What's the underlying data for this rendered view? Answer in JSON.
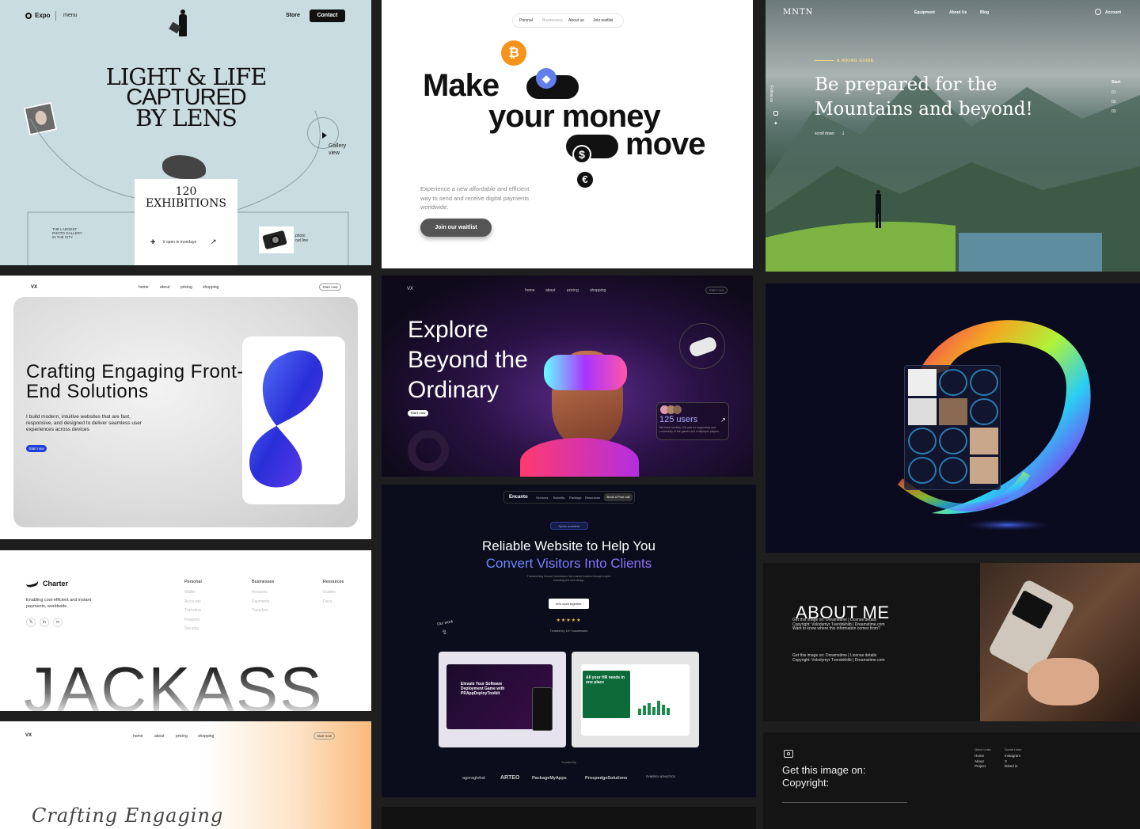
{
  "expo": {
    "logo": "Expo",
    "menu": "menu",
    "store": "Store",
    "contact": "Contact",
    "headline": [
      "LIGHT & LIFE",
      "CAPTURED",
      "BY LENS"
    ],
    "gallery": "Gallery\nview",
    "exhibitions_count": "120",
    "exhibitions_label": "EXHIBITIONS",
    "open_text": "it open in mondays",
    "largest": "THE LARGEST\nPHOTO GALLERY\nIN THE CITY",
    "photo_online": "photo\nout line"
  },
  "money": {
    "nav": [
      "Porsnal",
      "Businesses",
      "About us",
      "Join waitlist"
    ],
    "headline_1": "Make",
    "headline_2": "your money",
    "headline_3": "move",
    "desc": "Experience a new affordable and efficient way to send and receive digital payments worldwide.",
    "cta": "Join our waitlist",
    "coin_colors": {
      "btc": "#f7931a",
      "eth": "#627eea"
    }
  },
  "mntn": {
    "logo": "MNTN",
    "nav": [
      "Equipment",
      "About Us",
      "Blog"
    ],
    "account": "Account",
    "kicker": "A HIKING GUIDE",
    "headline": "Be prepared for the Mountains and beyond!",
    "scroll": "scroll down",
    "side": [
      "Start",
      "01",
      "02",
      "03"
    ],
    "follow": "Follow us"
  },
  "craft": {
    "logo": "VX",
    "nav": [
      "home",
      "about",
      "pricing",
      "shopping"
    ],
    "start_now": "Start now",
    "headline": "Crafting Engaging Front-End Solutions",
    "desc": "I build modern, intuitive websites that are fast, responsive, and designed to deliver seamless user experiences across devices",
    "cta": "Start now"
  },
  "explore": {
    "logo": "VX",
    "nav": [
      "home",
      "about",
      "pricing",
      "shopping"
    ],
    "start_now": "Start now",
    "headline": "Explore Beyond the Ordinary",
    "cta": "Start now",
    "users": "125 users",
    "users_desc": "We have monthly 125 user for supporting and community of the games and multiplayer players"
  },
  "charter": {
    "brand": "Charter",
    "tagline": "Enabling cost-efficient and instant payments, worldwide.",
    "columns": [
      {
        "title": "Personal",
        "items": [
          "Wallet",
          "Accounts",
          "Transfers",
          "Features",
          "Security"
        ]
      },
      {
        "title": "Businesses",
        "items": [
          "Features",
          "Payments",
          "Transfers"
        ]
      },
      {
        "title": "Resources",
        "items": [
          "Guides",
          "Docs"
        ]
      }
    ],
    "big_word": "JACKASS"
  },
  "encanto": {
    "logo": "Encanto",
    "nav": [
      "Services",
      "Benefits",
      "Package",
      "Resources"
    ],
    "book": "Book a Free call",
    "badge": "Spots available",
    "headline_1": "Reliable Website to Help You",
    "headline_2": "Convert Visitors Into Clients",
    "sub": "Transforming finance businesses into market leaders through expert branding and web design",
    "cta": "let's work together",
    "stars": "★★★★★",
    "trusted": "Trusted by 10+ businesses",
    "our_work": "Our work",
    "card1_title": "Elevate Your Software Deployment Game with PRAppDeployToolkit",
    "card2_title": "All your HR needs in one place",
    "trusted_by": "Trusted By",
    "logos": [
      "agoraglobal",
      "ARTEO",
      "PackageMyApps",
      "ProspedgeSolutions",
      "SYNERGY ATHLETICS"
    ]
  },
  "about": {
    "headline": "ABOUT ME",
    "p1": "Get this image on: Dreamstime | License details Copyright: Volodymyr Tverdokhlib | Dreamstime.com Want to know where this information comes from?",
    "p2": "Get this image on: Dreamstime | License details Copyright: Volodymyr Tverdokhlib | Dreamstime.com"
  },
  "craft2": {
    "logo": "VX",
    "nav": [
      "home",
      "about",
      "pricing",
      "shopping"
    ],
    "start_now": "Start now",
    "script_text": "Crafting Engaging"
  },
  "getimg": {
    "line1": "Get this image on:",
    "line2": "Copyright:",
    "quick_title": "Quick Links",
    "quick": [
      "Home",
      "About",
      "Project"
    ],
    "social_title": "Social Links",
    "social": [
      "Instagram",
      "X",
      "linked in"
    ]
  }
}
